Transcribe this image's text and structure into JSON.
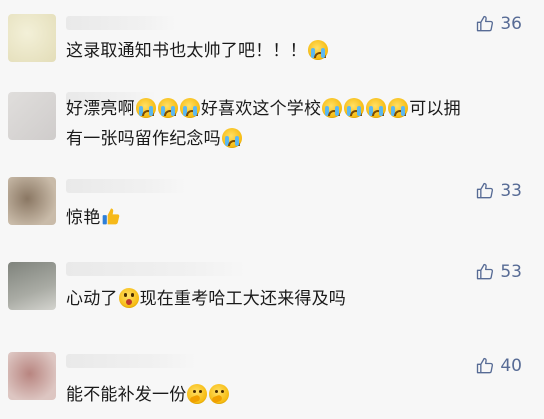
{
  "comments": [
    {
      "text_a": "这录取通知书也太帅了吧！！！",
      "text_b": "",
      "text_c": "",
      "text_d": "",
      "likes": "36",
      "avatar_color": "#e9e4c8"
    },
    {
      "text_a": "好漂亮啊",
      "text_b": "好喜欢这个学校",
      "text_c": "可以拥",
      "text_d": "有一张吗留作纪念吗",
      "likes": "",
      "avatar_color": "#d8d6d4"
    },
    {
      "text_a": "惊艳",
      "text_b": "",
      "text_c": "",
      "text_d": "",
      "likes": "33",
      "avatar_color": "#a99985"
    },
    {
      "text_a": "心动了",
      "text_b": "现在重考哈工大还来得及吗",
      "text_c": "",
      "text_d": "",
      "likes": "53",
      "avatar_color": "#8c8f88"
    },
    {
      "text_a": "能不能补发一份",
      "text_b": "",
      "text_c": "",
      "text_d": "",
      "likes": "40",
      "avatar_color": "#caa7a2"
    }
  ],
  "icons": {
    "like": "thumbs-up-icon",
    "cry": "loudly-crying-face-emoji",
    "shock": "surprised-face-emoji",
    "thumb": "thumbs-up-emoji",
    "think": "thinking-face-emoji"
  },
  "colors": {
    "accent": "#576b95",
    "background": "#f7f7f7",
    "text": "#1a1a1a"
  }
}
